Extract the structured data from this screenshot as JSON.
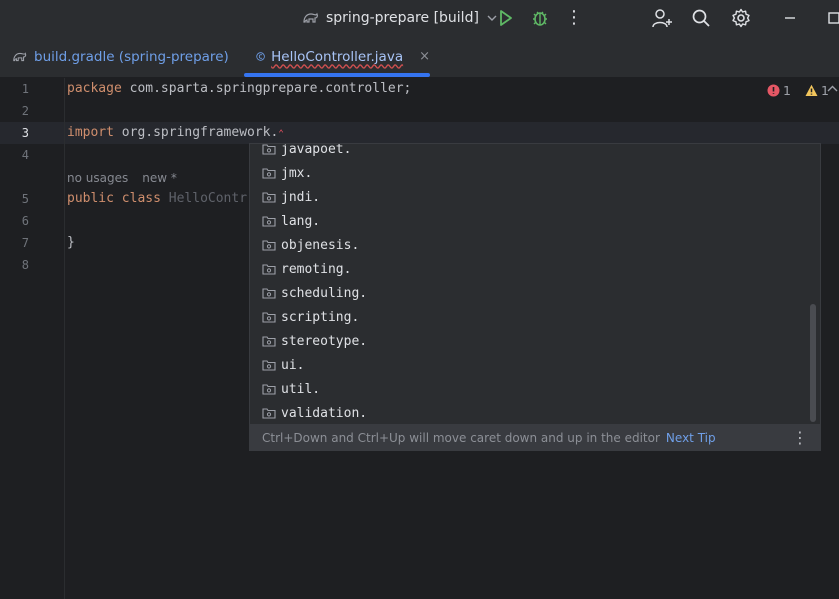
{
  "titlebar": {
    "run_config": "spring-prepare [build]",
    "icons": [
      "gradle-icon",
      "run-icon",
      "debug-icon",
      "more-vertical-icon",
      "add-user-icon",
      "search-icon",
      "gear-icon",
      "minimize-icon",
      "maximize-icon"
    ]
  },
  "tabs": [
    {
      "label": "build.gradle (spring-prepare)",
      "icon": "gradle-icon",
      "active": false
    },
    {
      "label": "HelloController.java",
      "icon": "class-icon",
      "active": true,
      "close": "×"
    }
  ],
  "editor": {
    "line_numbers": [
      "1",
      "2",
      "3",
      "4",
      "5",
      "6",
      "7",
      "8"
    ],
    "lines": {
      "l1_kw": "package",
      "l1_rest": " com.sparta.springprepare.controller;",
      "l3_kw": "import",
      "l3_rest": " org.springframework.",
      "l5_kw1": "public",
      "l5_kw2": "class",
      "l5_cls": "HelloContr",
      "l7": "}"
    },
    "hint_usages": "no usages",
    "hint_new": "new *",
    "inspections": {
      "errors": "1",
      "warnings": "1"
    }
  },
  "completion": {
    "items": [
      "javapoet.",
      "jmx.",
      "jndi.",
      "lang.",
      "objenesis.",
      "remoting.",
      "scheduling.",
      "scripting.",
      "stereotype.",
      "ui.",
      "util.",
      "validation."
    ],
    "footer_text": "Ctrl+Down and Ctrl+Up will move caret down and up in the editor",
    "next_tip": "Next Tip",
    "footer_more": "⋮"
  },
  "colors": {
    "accent": "#3574f0",
    "keyword": "#cf8e6d",
    "link": "#6f9fe8",
    "error": "#f75464",
    "warning": "#f2c55c",
    "run": "#5fb865"
  }
}
